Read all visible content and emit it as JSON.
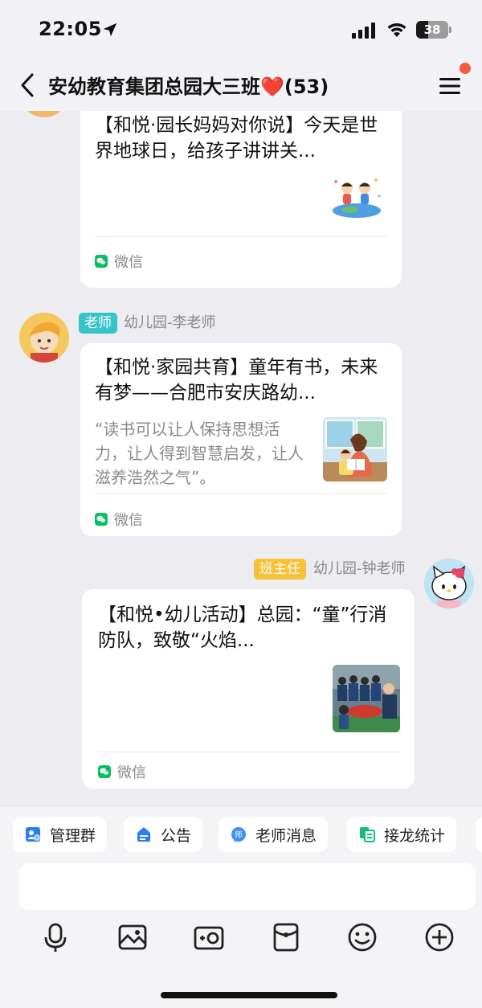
{
  "status_bar": {
    "time": "22:05",
    "battery_text": "38",
    "battery_level": 0.38,
    "icons": [
      "location-arrow-icon",
      "signal-icon",
      "wifi-icon",
      "battery-icon"
    ]
  },
  "nav": {
    "title": "安幼教育集团总园大三班❤️(53)",
    "has_notification_dot": true
  },
  "messages": [
    {
      "sender_role": "",
      "sender_name": "",
      "title": "【和悦·园长妈妈对你说】今天是世界地球日，给孩子讲讲关...",
      "description": "",
      "thumbnail": "children-earth-illustration",
      "source": "微信"
    },
    {
      "sender_role": "老师",
      "sender_name": "幼儿园-李老师",
      "title": "【和悦·家园共育】童年有书，未来有梦——合肥市安庆路幼...",
      "description": "“读书可以让人保持思想活力，让人得到智慧启发，让人滋养浩然之气”。",
      "thumbnail": "mother-reading-illustration",
      "source": "微信"
    },
    {
      "sender_role": "班主任",
      "sender_name": "幼儿园-钟老师",
      "title": "【和悦•幼儿活动】总园：“童”行消防队，致敬“火焰...",
      "description": "",
      "thumbnail": "firefighter-children-photo",
      "source": "微信"
    }
  ],
  "quick_actions": [
    {
      "label": "管理群",
      "icon": "manage-group-icon"
    },
    {
      "label": "公告",
      "icon": "announcement-icon"
    },
    {
      "label": "老师消息",
      "icon": "teacher-message-icon"
    },
    {
      "label": "接龙统计",
      "icon": "relay-stats-icon"
    }
  ],
  "input": {
    "placeholder": ""
  },
  "toolbar": [
    "microphone-icon",
    "image-icon",
    "camera-icon",
    "red-packet-icon",
    "emoji-icon",
    "plus-icon"
  ],
  "colors": {
    "teacher_badge": "#36c4c8",
    "head_teacher_badge": "#f7c23a",
    "notification_dot": "#f45b3f",
    "wechat_green": "#07c160"
  }
}
